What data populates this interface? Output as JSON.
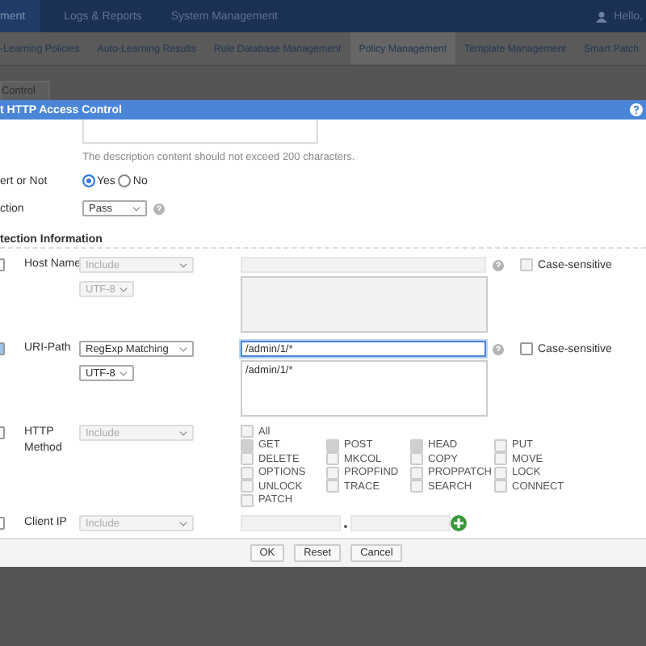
{
  "top_nav": {
    "items": [
      {
        "label": "ment",
        "selected": true
      },
      {
        "label": "Logs & Reports",
        "selected": false
      },
      {
        "label": "System Management",
        "selected": false
      }
    ],
    "user": "Hello,"
  },
  "sub_nav": [
    {
      "label": "-Learning Policies",
      "selected": false
    },
    {
      "label": "Auto-Learning Results",
      "selected": false
    },
    {
      "label": "Rule Database Management",
      "selected": false
    },
    {
      "label": "Policy Management",
      "selected": true
    },
    {
      "label": "Template Management",
      "selected": false
    },
    {
      "label": "Smart Patch",
      "selected": false
    }
  ],
  "page_tab": "Control",
  "dialog": {
    "title": "t HTTP Access Control",
    "description_note": "The description content should not exceed 200 characters.",
    "assert": {
      "label": "ert or Not",
      "options": [
        {
          "label": "Yes",
          "selected": true
        },
        {
          "label": "No",
          "selected": false
        }
      ]
    },
    "action": {
      "label": "ction",
      "value": "Pass"
    },
    "section_title": "tection Information",
    "rules": [
      {
        "kind": "text",
        "label": "Host Name",
        "checked": false,
        "match": "Include",
        "encoding": "UTF-8",
        "case_label": "Case-sensitive",
        "case_sensitive": false
      },
      {
        "kind": "text",
        "label": "URI-Path",
        "checked": true,
        "match": "RegExp Matching",
        "encoding": "UTF-8",
        "value": "/admin/1/*",
        "list_value": "/admin/1/*",
        "case_label": "Case-sensitive",
        "case_sensitive": false
      },
      {
        "kind": "methods",
        "label": "HTTP Method",
        "checked": false,
        "match": "Include",
        "all": {
          "label": "All",
          "checked": false
        },
        "methods": [
          {
            "label": "GET",
            "checked": true
          },
          {
            "label": "POST",
            "checked": true
          },
          {
            "label": "HEAD",
            "checked": true
          },
          {
            "label": "PUT",
            "checked": false
          },
          {
            "label": "DELETE",
            "checked": false
          },
          {
            "label": "MKCOL",
            "checked": false
          },
          {
            "label": "COPY",
            "checked": false
          },
          {
            "label": "MOVE",
            "checked": false
          },
          {
            "label": "OPTIONS",
            "checked": false
          },
          {
            "label": "PROPFIND",
            "checked": false
          },
          {
            "label": "PROPPATCH",
            "checked": false
          },
          {
            "label": "LOCK",
            "checked": false
          },
          {
            "label": "UNLOCK",
            "checked": false
          },
          {
            "label": "TRACE",
            "checked": false
          },
          {
            "label": "SEARCH",
            "checked": false
          },
          {
            "label": "CONNECT",
            "checked": false
          },
          {
            "label": "PATCH",
            "checked": false
          }
        ]
      },
      {
        "kind": "ip",
        "label": "Client IP",
        "checked": false,
        "match": "Include"
      }
    ],
    "buttons": [
      "OK",
      "Reset",
      "Cancel"
    ]
  }
}
